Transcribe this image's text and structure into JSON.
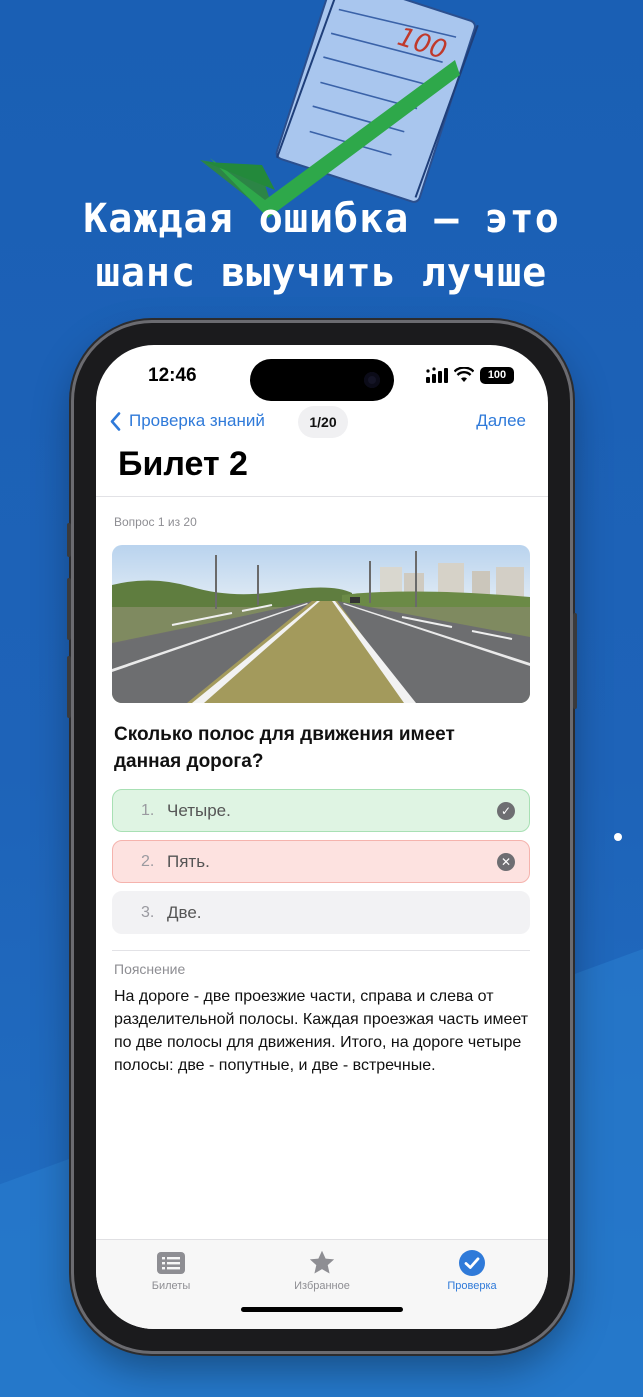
{
  "promo": {
    "headline_line1": "Каждая ошибка — это",
    "headline_line2": "шанс выучить лучше",
    "illustration_label": "100"
  },
  "status_bar": {
    "time": "12:46",
    "battery": "100"
  },
  "nav": {
    "back_label": "Проверка знаний",
    "counter": "1/20",
    "next_label": "Далее"
  },
  "page": {
    "title": "Билет 2",
    "question_meta": "Вопрос 1 из 20",
    "question": "Сколько полос для движения имеет данная дорога?"
  },
  "answers": [
    {
      "number": "1.",
      "text": "Четыре.",
      "state": "correct",
      "icon": "check-icon"
    },
    {
      "number": "2.",
      "text": "Пять.",
      "state": "wrong",
      "icon": "close-icon"
    },
    {
      "number": "3.",
      "text": "Две.",
      "state": "neutral",
      "icon": ""
    }
  ],
  "explanation": {
    "label": "Пояснение",
    "text": "На дороге - две проезжие части, справа и слева от разделительной полосы. Каждая проезжая часть имеет по две полосы для движения. Итого, на дороге четыре полосы: две - попутные, и две - встречные."
  },
  "tabbar": {
    "items": [
      {
        "label": "Билеты",
        "icon": "list-icon",
        "active": false
      },
      {
        "label": "Избранное",
        "icon": "star-icon",
        "active": false
      },
      {
        "label": "Проверка",
        "icon": "checkmark-circle-icon",
        "active": true
      }
    ]
  },
  "colors": {
    "background": "#1a5fb4",
    "accent": "#2f7ad9",
    "correct_bg": "#dff4e3",
    "wrong_bg": "#fde2e0"
  }
}
